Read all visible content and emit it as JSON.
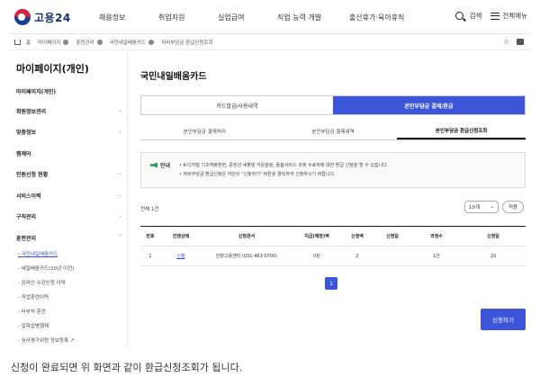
{
  "header": {
    "logo_text": "고용24",
    "nav": [
      "채용정보",
      "취업지원",
      "실업급여",
      "직업 능력 개발",
      "출산휴가·육아휴직"
    ],
    "search_label": "검색",
    "menu_label": "전체메뉴"
  },
  "breadcrumb": {
    "home": "홈",
    "items": [
      "마이페이지",
      "훈련관리",
      "국민내일배움카드",
      "자비부담금 환급신청조회"
    ]
  },
  "sidebar": {
    "title": "마이페이지(개인)",
    "subtitle": "마이페이지(개인)",
    "sections": [
      "회원정보관리",
      "맞춤정보",
      "찜제어",
      "민원신청 현황",
      "서비스이력",
      "구직관리",
      "훈련관리"
    ],
    "links": [
      "국민내일배움카드",
      "내일배움카드(20년 이전)",
      "온라인 수강신청 이력",
      "직업훈련이력",
      "타부처 훈련",
      "일학습병행제",
      "심사평가위원 정보등록"
    ],
    "external_mark": "↗"
  },
  "main": {
    "title": "국민내일배움카드",
    "tabs": [
      "카드발급/사용내역",
      "본인부담금 결제/환급"
    ],
    "subtabs": [
      "본인부담금 결제처리",
      "본인부담금 결제내역",
      "본인부담금 환급신청조회"
    ],
    "notice_label": "안내",
    "notice_lines": [
      "• K-디지털 기초역량훈련, 중장년 새출발 카운슬링, 돌봄서비스 과정 수료자에 대한 환급 신청을 할 수 있습니다.",
      "• 자비부담금 환급신청은 하단의 \"신청하기\" 버튼을 클릭하여 신청하시기 바랍니다."
    ],
    "count_text": "전체 1건",
    "page_size": "10개",
    "view_button": "적용",
    "table": {
      "headers": [
        "번호",
        "진행상태",
        "신청관서",
        "지급(예정)액",
        "신청액",
        "신청일",
        "과정수",
        "신청일"
      ],
      "rows": [
        [
          "1",
          "신청",
          "안양고용센터 (031-463-0700)",
          "0원",
          "",
          "",
          "1건",
          "20"
        ]
      ],
      "extra_cell": "2"
    },
    "page_number": "1",
    "apply_button": "신청하기"
  },
  "caption": "신청이 완료되면 위 화면과 같이 환급신청조회가 됩니다.",
  "colors": {
    "primary": "#3d55d8",
    "text": "#222222"
  }
}
